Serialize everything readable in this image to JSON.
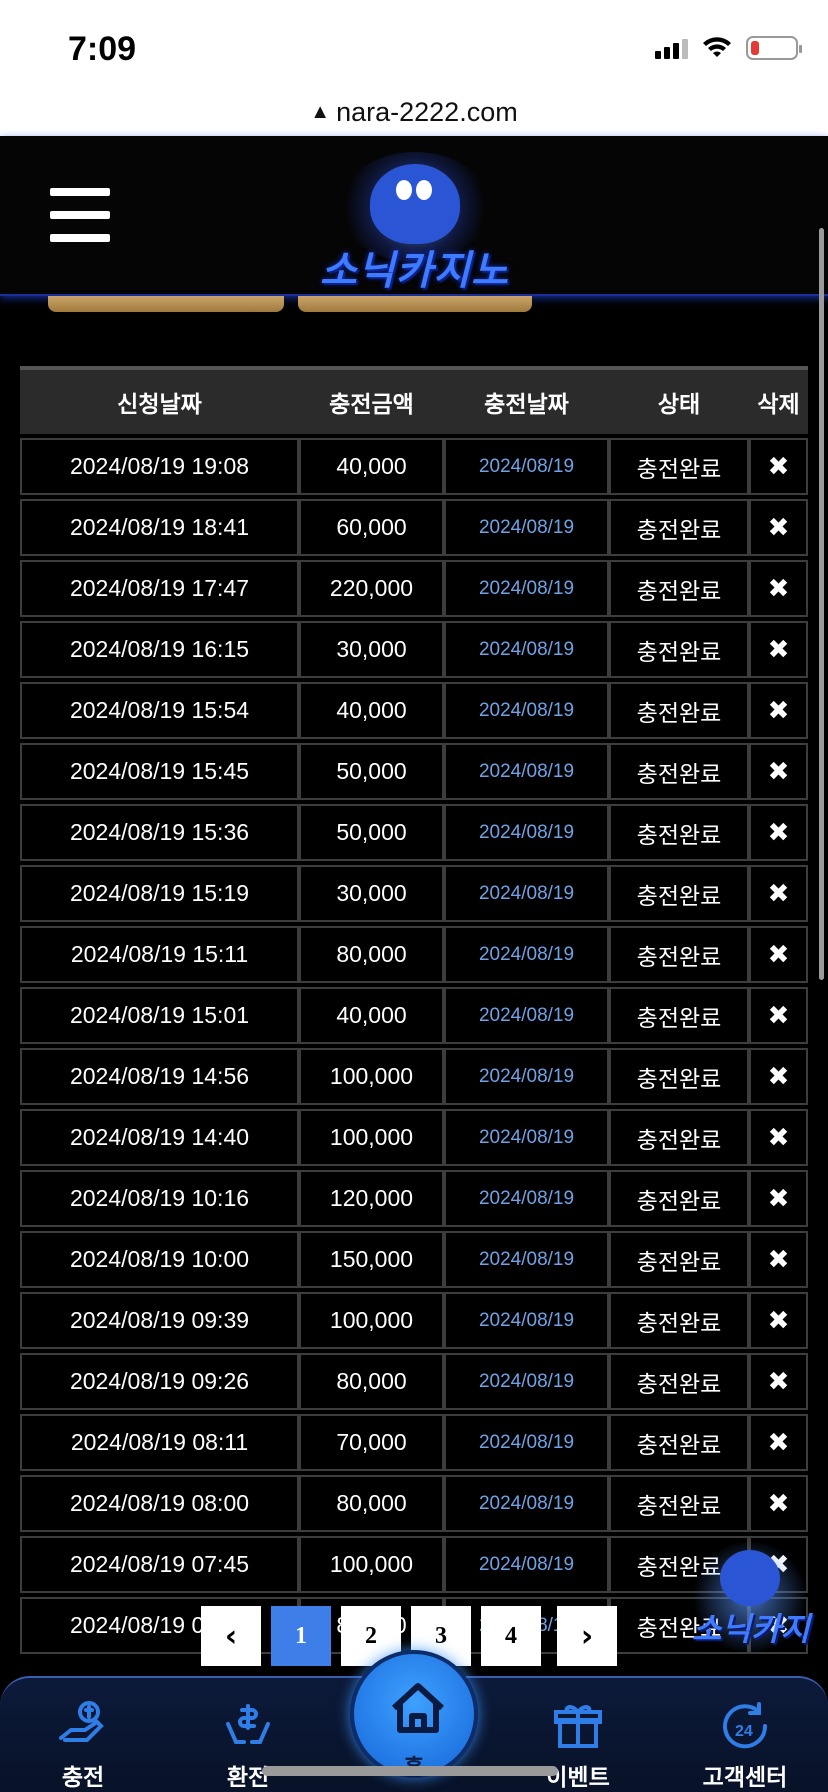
{
  "status_bar": {
    "time": "7:09"
  },
  "browser": {
    "url": "nara-2222.com"
  },
  "header": {
    "logo_text": "소닉카지노"
  },
  "table": {
    "columns": [
      "신청날짜",
      "충전금액",
      "충전날짜",
      "상태",
      "삭제"
    ],
    "rows": [
      {
        "request_date": "2024/08/19 19:08",
        "amount": "40,000",
        "charge_date": "2024/08/19",
        "status": "충전완료"
      },
      {
        "request_date": "2024/08/19 18:41",
        "amount": "60,000",
        "charge_date": "2024/08/19",
        "status": "충전완료"
      },
      {
        "request_date": "2024/08/19 17:47",
        "amount": "220,000",
        "charge_date": "2024/08/19",
        "status": "충전완료"
      },
      {
        "request_date": "2024/08/19 16:15",
        "amount": "30,000",
        "charge_date": "2024/08/19",
        "status": "충전완료"
      },
      {
        "request_date": "2024/08/19 15:54",
        "amount": "40,000",
        "charge_date": "2024/08/19",
        "status": "충전완료"
      },
      {
        "request_date": "2024/08/19 15:45",
        "amount": "50,000",
        "charge_date": "2024/08/19",
        "status": "충전완료"
      },
      {
        "request_date": "2024/08/19 15:36",
        "amount": "50,000",
        "charge_date": "2024/08/19",
        "status": "충전완료"
      },
      {
        "request_date": "2024/08/19 15:19",
        "amount": "30,000",
        "charge_date": "2024/08/19",
        "status": "충전완료"
      },
      {
        "request_date": "2024/08/19 15:11",
        "amount": "80,000",
        "charge_date": "2024/08/19",
        "status": "충전완료"
      },
      {
        "request_date": "2024/08/19 15:01",
        "amount": "40,000",
        "charge_date": "2024/08/19",
        "status": "충전완료"
      },
      {
        "request_date": "2024/08/19 14:56",
        "amount": "100,000",
        "charge_date": "2024/08/19",
        "status": "충전완료"
      },
      {
        "request_date": "2024/08/19 14:40",
        "amount": "100,000",
        "charge_date": "2024/08/19",
        "status": "충전완료"
      },
      {
        "request_date": "2024/08/19 10:16",
        "amount": "120,000",
        "charge_date": "2024/08/19",
        "status": "충전완료"
      },
      {
        "request_date": "2024/08/19 10:00",
        "amount": "150,000",
        "charge_date": "2024/08/19",
        "status": "충전완료"
      },
      {
        "request_date": "2024/08/19 09:39",
        "amount": "100,000",
        "charge_date": "2024/08/19",
        "status": "충전완료"
      },
      {
        "request_date": "2024/08/19 09:26",
        "amount": "80,000",
        "charge_date": "2024/08/19",
        "status": "충전완료"
      },
      {
        "request_date": "2024/08/19 08:11",
        "amount": "70,000",
        "charge_date": "2024/08/19",
        "status": "충전완료"
      },
      {
        "request_date": "2024/08/19 08:00",
        "amount": "80,000",
        "charge_date": "2024/08/19",
        "status": "충전완료"
      },
      {
        "request_date": "2024/08/19 07:45",
        "amount": "100,000",
        "charge_date": "2024/08/19",
        "status": "충전완료"
      },
      {
        "request_date": "2024/08/19 06:32",
        "amount": "80,000",
        "charge_date": "2024/08/19",
        "status": "충전완료"
      }
    ],
    "delete_icon": "✖"
  },
  "pagination": {
    "prev": "‹",
    "next": "›",
    "pages": [
      "1",
      "2",
      "3",
      "4"
    ],
    "current": "1"
  },
  "float_badge": {
    "text": "소닉카지"
  },
  "bottom_nav": {
    "items": [
      {
        "label": "충전",
        "icon": "hand-coin-icon"
      },
      {
        "label": "환전",
        "icon": "dollar-hands-icon"
      },
      {
        "label": "이벤트",
        "icon": "gift-icon"
      },
      {
        "label": "고객센터",
        "icon": "support-24-icon"
      }
    ],
    "home_label": "홈"
  },
  "colors": {
    "accent_blue": "#3d7ee8",
    "charge_date_blue": "#6fa3e6",
    "header_bg": "#2b2b2b"
  }
}
